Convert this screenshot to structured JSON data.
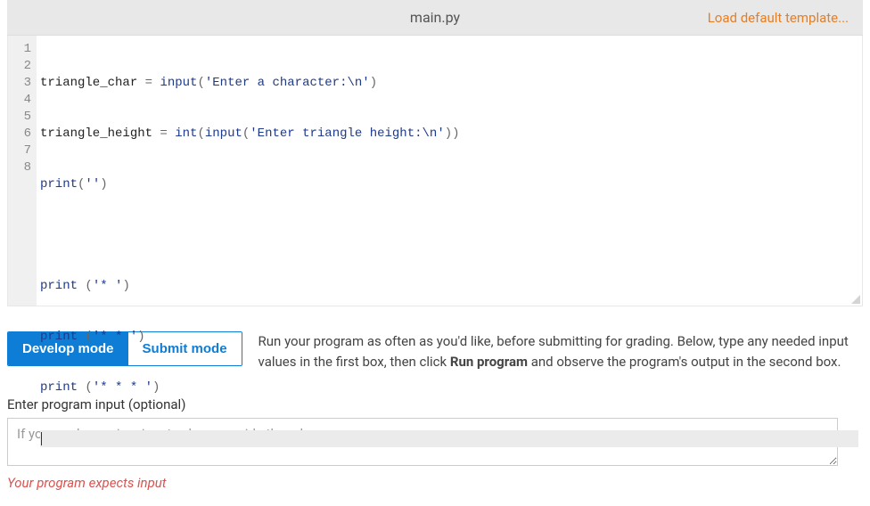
{
  "editor": {
    "filename": "main.py",
    "load_template_label": "Load default template...",
    "gutter": [
      "1",
      "2",
      "3",
      "4",
      "5",
      "6",
      "7",
      "8"
    ],
    "lines": {
      "l1": {
        "id1": "triangle_char ",
        "op1": "= ",
        "fn1": "input",
        "paren1": "(",
        "str1": "'Enter a character:\\n'",
        "paren2": ")"
      },
      "l2": {
        "id1": "triangle_height ",
        "op1": "= ",
        "fn1": "int",
        "paren1": "(",
        "fn2": "input",
        "paren2": "(",
        "str1": "'Enter triangle height:\\n'",
        "paren3": "))"
      },
      "l3": {
        "fn1": "print",
        "paren1": "(",
        "str1": "''",
        "paren2": ")"
      },
      "l5": {
        "fn1": "print ",
        "paren1": "(",
        "str1": "'* '",
        "paren2": ")"
      },
      "l6": {
        "fn1": "print ",
        "paren1": "(",
        "str1": "'* * '",
        "paren2": ")"
      },
      "l7": {
        "fn1": "print ",
        "paren1": "(",
        "str1": "'* * * '",
        "paren2": ")"
      }
    }
  },
  "modes": {
    "develop": "Develop mode",
    "submit": "Submit mode"
  },
  "instructions": {
    "part1": "Run your program as often as you'd like, before submitting for grading. Below, type any needed input values in the first box, then click ",
    "bold": "Run program",
    "part2": " and observe the program's output in the second box."
  },
  "input_section": {
    "label": "Enter program input (optional)",
    "placeholder": "If your code requires input values, provide them here.",
    "value": ""
  },
  "warning": "Your program expects input"
}
